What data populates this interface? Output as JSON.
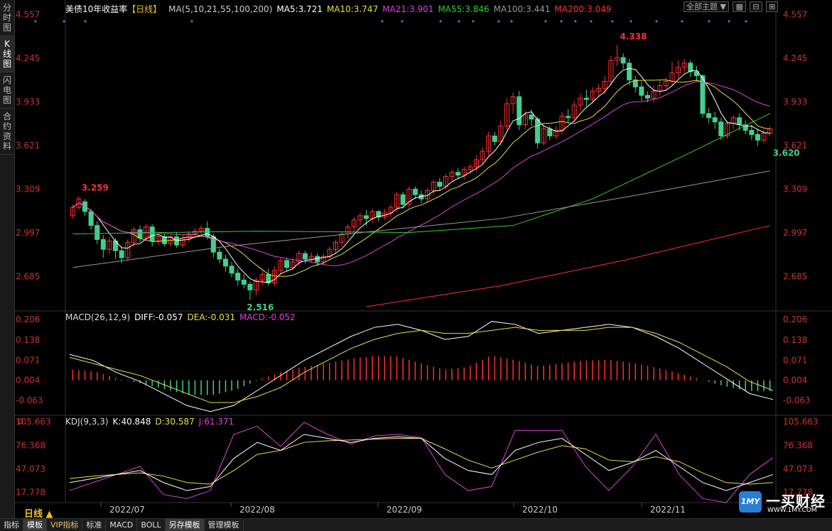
{
  "sidebar_tabs": [
    "分时图",
    "K线图",
    "闪电图",
    "合约资料"
  ],
  "title": "美债10年收益率",
  "period_tag": "【日线】",
  "ma_legend": {
    "label": "MA(5,10,21,55,100,200)",
    "items": [
      {
        "text": "MA5:3.721",
        "color": "#ffffff"
      },
      {
        "text": "MA10:3.747",
        "color": "#e8e040"
      },
      {
        "text": "MA21:3.901",
        "color": "#e040e0"
      },
      {
        "text": "MA55:3.846",
        "color": "#30d030"
      },
      {
        "text": "MA100:3.441",
        "color": "#999999"
      },
      {
        "text": "MA200:3.049",
        "color": "#ff3030"
      }
    ]
  },
  "theme_select": "全部主题",
  "price_ticks": [
    "4.557",
    "4.245",
    "3.933",
    "3.621",
    "3.309",
    "2.997",
    "2.685"
  ],
  "annotations": {
    "high1": "3.259",
    "low": "2.516",
    "high2": "4.338",
    "last_low": "3.620"
  },
  "macd_legend": {
    "label": "MACD(26,12,9)",
    "diff": "DIFF:-0.057",
    "dea": "DEA:-0.031",
    "macd": "MACD:-0.052"
  },
  "macd_ticks": [
    "0.206",
    "0.138",
    "0.071",
    "0.004",
    "-0.063"
  ],
  "kdj_legend": {
    "label": "KDJ(9,3,3)",
    "k": "K:40.848",
    "d": "D:30.587",
    "j": "J:61.371"
  },
  "kdj_ticks": [
    "105.663",
    "76.368",
    "47.073",
    "17.778"
  ],
  "months": [
    "2022/07",
    "2022/08",
    "2022/09",
    "2022/10",
    "2022/11"
  ],
  "period_label": "日线 ▲",
  "bottom_tabs": [
    "指标",
    "模板",
    "VIP指标",
    "标准",
    "MACD",
    "BOLL",
    "另存模板",
    "管理模板"
  ],
  "logo": {
    "brand": "一买财经",
    "url": "WWW.1MY.COM",
    "mark": "1MY"
  },
  "colors": {
    "up": "#ff3030",
    "down": "#40d090",
    "axis": "#d03030",
    "grid": "#333333"
  },
  "chart_data": {
    "type": "candlestick",
    "title": "美债10年收益率 日线",
    "ylim": [
      2.45,
      4.6
    ],
    "candles": [
      [
        3.12,
        3.18,
        3.1,
        3.2
      ],
      [
        3.18,
        3.24,
        3.16,
        3.26
      ],
      [
        3.22,
        3.15,
        3.12,
        3.24
      ],
      [
        3.15,
        3.05,
        3.02,
        3.17
      ],
      [
        3.05,
        2.95,
        2.92,
        3.08
      ],
      [
        2.95,
        2.88,
        2.82,
        2.98
      ],
      [
        2.88,
        2.94,
        2.85,
        2.97
      ],
      [
        2.94,
        2.87,
        2.81,
        2.96
      ],
      [
        2.87,
        2.82,
        2.78,
        2.9
      ],
      [
        2.82,
        2.93,
        2.8,
        2.95
      ],
      [
        2.93,
        3.02,
        2.9,
        3.04
      ],
      [
        3.02,
        2.96,
        2.93,
        3.05
      ],
      [
        2.96,
        3.04,
        2.94,
        3.06
      ],
      [
        3.04,
        2.94,
        2.9,
        3.06
      ],
      [
        2.94,
        2.97,
        2.91,
        2.99
      ],
      [
        2.97,
        2.92,
        2.9,
        2.99
      ],
      [
        2.92,
        2.97,
        2.9,
        2.98
      ],
      [
        2.97,
        2.91,
        2.89,
        3.0
      ],
      [
        2.91,
        2.96,
        2.89,
        2.98
      ],
      [
        2.96,
        2.99,
        2.93,
        3.01
      ],
      [
        2.99,
        3.01,
        2.96,
        3.03
      ],
      [
        3.01,
        3.03,
        2.98,
        3.05
      ],
      [
        3.03,
        2.97,
        2.95,
        3.08
      ],
      [
        2.97,
        2.86,
        2.82,
        2.99
      ],
      [
        2.86,
        2.81,
        2.78,
        2.89
      ],
      [
        2.81,
        2.76,
        2.72,
        2.84
      ],
      [
        2.76,
        2.71,
        2.68,
        2.79
      ],
      [
        2.71,
        2.66,
        2.62,
        2.74
      ],
      [
        2.66,
        2.63,
        2.6,
        2.7
      ],
      [
        2.63,
        2.59,
        2.52,
        2.65
      ],
      [
        2.59,
        2.66,
        2.55,
        2.68
      ],
      [
        2.66,
        2.7,
        2.62,
        2.73
      ],
      [
        2.7,
        2.64,
        2.62,
        2.74
      ],
      [
        2.64,
        2.73,
        2.62,
        2.76
      ],
      [
        2.73,
        2.8,
        2.7,
        2.82
      ],
      [
        2.8,
        2.75,
        2.72,
        2.82
      ],
      [
        2.75,
        2.79,
        2.73,
        2.82
      ],
      [
        2.79,
        2.85,
        2.76,
        2.87
      ],
      [
        2.85,
        2.81,
        2.78,
        2.87
      ],
      [
        2.81,
        2.83,
        2.78,
        2.86
      ],
      [
        2.83,
        2.79,
        2.76,
        2.85
      ],
      [
        2.79,
        2.83,
        2.77,
        2.85
      ],
      [
        2.83,
        2.88,
        2.8,
        2.9
      ],
      [
        2.88,
        2.93,
        2.85,
        2.95
      ],
      [
        2.93,
        2.99,
        2.9,
        3.01
      ],
      [
        2.99,
        3.04,
        2.96,
        3.06
      ],
      [
        3.04,
        3.09,
        3.0,
        3.11
      ],
      [
        3.09,
        3.12,
        3.05,
        3.14
      ],
      [
        3.12,
        3.1,
        3.05,
        3.16
      ],
      [
        3.1,
        3.15,
        3.07,
        3.17
      ],
      [
        3.15,
        3.11,
        3.08,
        3.16
      ],
      [
        3.11,
        3.14,
        3.09,
        3.17
      ],
      [
        3.14,
        3.18,
        3.11,
        3.2
      ],
      [
        3.18,
        3.27,
        3.15,
        3.29
      ],
      [
        3.27,
        3.2,
        3.17,
        3.29
      ],
      [
        3.2,
        3.31,
        3.18,
        3.33
      ],
      [
        3.31,
        3.27,
        3.24,
        3.33
      ],
      [
        3.27,
        3.24,
        3.21,
        3.3
      ],
      [
        3.24,
        3.3,
        3.22,
        3.32
      ],
      [
        3.3,
        3.36,
        3.27,
        3.38
      ],
      [
        3.36,
        3.33,
        3.3,
        3.39
      ],
      [
        3.33,
        3.4,
        3.31,
        3.42
      ],
      [
        3.4,
        3.43,
        3.37,
        3.45
      ],
      [
        3.43,
        3.41,
        3.38,
        3.46
      ],
      [
        3.41,
        3.45,
        3.38,
        3.47
      ],
      [
        3.45,
        3.47,
        3.42,
        3.49
      ],
      [
        3.47,
        3.52,
        3.44,
        3.55
      ],
      [
        3.52,
        3.58,
        3.49,
        3.61
      ],
      [
        3.58,
        3.69,
        3.55,
        3.72
      ],
      [
        3.69,
        3.65,
        3.62,
        3.72
      ],
      [
        3.65,
        3.76,
        3.62,
        3.8
      ],
      [
        3.76,
        3.92,
        3.73,
        3.96
      ],
      [
        3.92,
        3.97,
        3.85,
        4.0
      ],
      [
        3.97,
        3.77,
        3.73,
        4.01
      ],
      [
        3.77,
        3.84,
        3.74,
        3.87
      ],
      [
        3.84,
        3.81,
        3.76,
        3.88
      ],
      [
        3.81,
        3.64,
        3.6,
        3.83
      ],
      [
        3.64,
        3.74,
        3.62,
        3.77
      ],
      [
        3.74,
        3.69,
        3.66,
        3.76
      ],
      [
        3.69,
        3.73,
        3.67,
        3.76
      ],
      [
        3.73,
        3.83,
        3.7,
        3.86
      ],
      [
        3.83,
        3.82,
        3.78,
        3.88
      ],
      [
        3.82,
        3.91,
        3.79,
        3.94
      ],
      [
        3.91,
        3.96,
        3.87,
        3.99
      ],
      [
        3.96,
        3.95,
        3.9,
        4.02
      ],
      [
        3.95,
        4.01,
        3.92,
        4.04
      ],
      [
        4.01,
        4.03,
        3.97,
        4.06
      ],
      [
        4.03,
        4.08,
        3.99,
        4.12
      ],
      [
        4.08,
        4.23,
        4.05,
        4.26
      ],
      [
        4.23,
        4.25,
        4.19,
        4.34
      ],
      [
        4.25,
        4.21,
        4.17,
        4.28
      ],
      [
        4.21,
        4.09,
        4.05,
        4.24
      ],
      [
        4.09,
        4.04,
        4.0,
        4.12
      ],
      [
        4.04,
        3.98,
        3.94,
        4.08
      ],
      [
        3.98,
        3.96,
        3.93,
        4.01
      ],
      [
        3.96,
        4.01,
        3.93,
        4.05
      ],
      [
        4.01,
        4.05,
        3.98,
        4.09
      ],
      [
        4.05,
        4.08,
        4.02,
        4.11
      ],
      [
        4.08,
        4.14,
        4.05,
        4.22
      ],
      [
        4.14,
        4.18,
        4.1,
        4.23
      ],
      [
        4.18,
        4.21,
        4.14,
        4.24
      ],
      [
        4.21,
        4.15,
        4.11,
        4.23
      ],
      [
        4.15,
        4.12,
        4.08,
        4.19
      ],
      [
        4.12,
        3.85,
        3.82,
        4.13
      ],
      [
        3.85,
        3.82,
        3.78,
        3.89
      ],
      [
        3.82,
        3.79,
        3.74,
        3.86
      ],
      [
        3.79,
        3.69,
        3.66,
        3.82
      ],
      [
        3.69,
        3.78,
        3.67,
        3.8
      ],
      [
        3.78,
        3.82,
        3.74,
        3.84
      ],
      [
        3.82,
        3.77,
        3.73,
        3.85
      ],
      [
        3.77,
        3.73,
        3.7,
        3.8
      ],
      [
        3.73,
        3.7,
        3.66,
        3.77
      ],
      [
        3.7,
        3.66,
        3.62,
        3.74
      ],
      [
        3.66,
        3.71,
        3.64,
        3.73
      ],
      [
        3.71,
        3.74,
        3.69,
        3.76
      ]
    ],
    "moving_averages": [
      {
        "name": "MA5",
        "color": "#ffffff"
      },
      {
        "name": "MA10",
        "color": "#e8e040"
      },
      {
        "name": "MA21",
        "color": "#e040e0"
      },
      {
        "name": "MA55",
        "color": "#30d030",
        "preset": [
          [
            0,
            2.99
          ],
          [
            30,
            3.01
          ],
          [
            55,
            3.0
          ],
          [
            72,
            3.05
          ],
          [
            85,
            3.24
          ],
          [
            100,
            3.55
          ],
          [
            114,
            3.85
          ]
        ]
      },
      {
        "name": "MA100",
        "color": "#999999",
        "preset": [
          [
            0,
            2.75
          ],
          [
            25,
            2.9
          ],
          [
            45,
            2.99
          ],
          [
            70,
            3.1
          ],
          [
            90,
            3.25
          ],
          [
            114,
            3.44
          ]
        ]
      },
      {
        "name": "MA200",
        "color": "#ff3030",
        "preset": [
          [
            48,
            2.47
          ],
          [
            70,
            2.62
          ],
          [
            90,
            2.8
          ],
          [
            114,
            3.05
          ]
        ]
      }
    ],
    "macd": {
      "ylim": [
        -0.11,
        0.23
      ],
      "diff": [
        0.09,
        0.07,
        0.03,
        0.0,
        -0.04,
        -0.08,
        -0.1,
        -0.08,
        -0.03,
        0.02,
        0.07,
        0.11,
        0.15,
        0.18,
        0.19,
        0.17,
        0.14,
        0.15,
        0.2,
        0.19,
        0.16,
        0.17,
        0.18,
        0.19,
        0.18,
        0.15,
        0.11,
        0.06,
        0.01,
        -0.04,
        -0.06
      ],
      "dea": [
        0.08,
        0.06,
        0.04,
        0.02,
        -0.01,
        -0.04,
        -0.07,
        -0.07,
        -0.05,
        -0.02,
        0.03,
        0.07,
        0.11,
        0.14,
        0.16,
        0.17,
        0.16,
        0.16,
        0.17,
        0.18,
        0.17,
        0.17,
        0.17,
        0.18,
        0.18,
        0.16,
        0.13,
        0.09,
        0.05,
        0.0,
        -0.03
      ]
    },
    "kdj": {
      "ylim": [
        5,
        112
      ],
      "k": [
        30,
        35,
        40,
        45,
        30,
        20,
        25,
        60,
        80,
        70,
        90,
        85,
        80,
        85,
        87,
        85,
        60,
        45,
        40,
        70,
        80,
        85,
        65,
        45,
        55,
        70,
        50,
        30,
        20,
        30,
        40
      ],
      "d": [
        35,
        38,
        40,
        42,
        38,
        30,
        28,
        45,
        65,
        70,
        80,
        82,
        83,
        84,
        85,
        85,
        72,
        58,
        48,
        58,
        68,
        76,
        72,
        58,
        56,
        62,
        56,
        42,
        30,
        28,
        30
      ],
      "j": [
        20,
        30,
        40,
        50,
        15,
        10,
        20,
        90,
        100,
        75,
        105,
        90,
        78,
        88,
        90,
        86,
        40,
        20,
        25,
        95,
        95,
        95,
        50,
        20,
        50,
        90,
        40,
        10,
        5,
        40,
        61
      ]
    }
  }
}
